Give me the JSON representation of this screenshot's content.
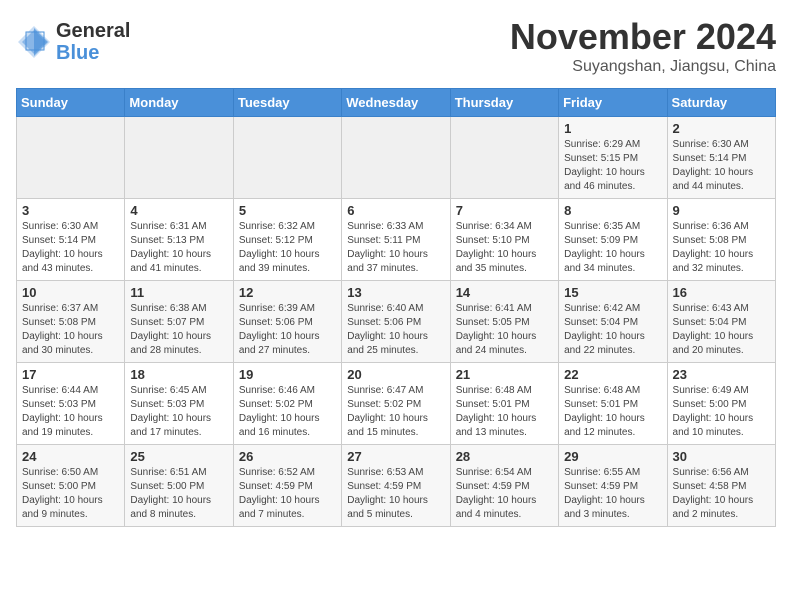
{
  "header": {
    "logo_line1": "General",
    "logo_line2": "Blue",
    "month_title": "November 2024",
    "location": "Suyangshan, Jiangsu, China"
  },
  "days_of_week": [
    "Sunday",
    "Monday",
    "Tuesday",
    "Wednesday",
    "Thursday",
    "Friday",
    "Saturday"
  ],
  "weeks": [
    [
      {
        "day": "",
        "info": ""
      },
      {
        "day": "",
        "info": ""
      },
      {
        "day": "",
        "info": ""
      },
      {
        "day": "",
        "info": ""
      },
      {
        "day": "",
        "info": ""
      },
      {
        "day": "1",
        "info": "Sunrise: 6:29 AM\nSunset: 5:15 PM\nDaylight: 10 hours\nand 46 minutes."
      },
      {
        "day": "2",
        "info": "Sunrise: 6:30 AM\nSunset: 5:14 PM\nDaylight: 10 hours\nand 44 minutes."
      }
    ],
    [
      {
        "day": "3",
        "info": "Sunrise: 6:30 AM\nSunset: 5:14 PM\nDaylight: 10 hours\nand 43 minutes."
      },
      {
        "day": "4",
        "info": "Sunrise: 6:31 AM\nSunset: 5:13 PM\nDaylight: 10 hours\nand 41 minutes."
      },
      {
        "day": "5",
        "info": "Sunrise: 6:32 AM\nSunset: 5:12 PM\nDaylight: 10 hours\nand 39 minutes."
      },
      {
        "day": "6",
        "info": "Sunrise: 6:33 AM\nSunset: 5:11 PM\nDaylight: 10 hours\nand 37 minutes."
      },
      {
        "day": "7",
        "info": "Sunrise: 6:34 AM\nSunset: 5:10 PM\nDaylight: 10 hours\nand 35 minutes."
      },
      {
        "day": "8",
        "info": "Sunrise: 6:35 AM\nSunset: 5:09 PM\nDaylight: 10 hours\nand 34 minutes."
      },
      {
        "day": "9",
        "info": "Sunrise: 6:36 AM\nSunset: 5:08 PM\nDaylight: 10 hours\nand 32 minutes."
      }
    ],
    [
      {
        "day": "10",
        "info": "Sunrise: 6:37 AM\nSunset: 5:08 PM\nDaylight: 10 hours\nand 30 minutes."
      },
      {
        "day": "11",
        "info": "Sunrise: 6:38 AM\nSunset: 5:07 PM\nDaylight: 10 hours\nand 28 minutes."
      },
      {
        "day": "12",
        "info": "Sunrise: 6:39 AM\nSunset: 5:06 PM\nDaylight: 10 hours\nand 27 minutes."
      },
      {
        "day": "13",
        "info": "Sunrise: 6:40 AM\nSunset: 5:06 PM\nDaylight: 10 hours\nand 25 minutes."
      },
      {
        "day": "14",
        "info": "Sunrise: 6:41 AM\nSunset: 5:05 PM\nDaylight: 10 hours\nand 24 minutes."
      },
      {
        "day": "15",
        "info": "Sunrise: 6:42 AM\nSunset: 5:04 PM\nDaylight: 10 hours\nand 22 minutes."
      },
      {
        "day": "16",
        "info": "Sunrise: 6:43 AM\nSunset: 5:04 PM\nDaylight: 10 hours\nand 20 minutes."
      }
    ],
    [
      {
        "day": "17",
        "info": "Sunrise: 6:44 AM\nSunset: 5:03 PM\nDaylight: 10 hours\nand 19 minutes."
      },
      {
        "day": "18",
        "info": "Sunrise: 6:45 AM\nSunset: 5:03 PM\nDaylight: 10 hours\nand 17 minutes."
      },
      {
        "day": "19",
        "info": "Sunrise: 6:46 AM\nSunset: 5:02 PM\nDaylight: 10 hours\nand 16 minutes."
      },
      {
        "day": "20",
        "info": "Sunrise: 6:47 AM\nSunset: 5:02 PM\nDaylight: 10 hours\nand 15 minutes."
      },
      {
        "day": "21",
        "info": "Sunrise: 6:48 AM\nSunset: 5:01 PM\nDaylight: 10 hours\nand 13 minutes."
      },
      {
        "day": "22",
        "info": "Sunrise: 6:48 AM\nSunset: 5:01 PM\nDaylight: 10 hours\nand 12 minutes."
      },
      {
        "day": "23",
        "info": "Sunrise: 6:49 AM\nSunset: 5:00 PM\nDaylight: 10 hours\nand 10 minutes."
      }
    ],
    [
      {
        "day": "24",
        "info": "Sunrise: 6:50 AM\nSunset: 5:00 PM\nDaylight: 10 hours\nand 9 minutes."
      },
      {
        "day": "25",
        "info": "Sunrise: 6:51 AM\nSunset: 5:00 PM\nDaylight: 10 hours\nand 8 minutes."
      },
      {
        "day": "26",
        "info": "Sunrise: 6:52 AM\nSunset: 4:59 PM\nDaylight: 10 hours\nand 7 minutes."
      },
      {
        "day": "27",
        "info": "Sunrise: 6:53 AM\nSunset: 4:59 PM\nDaylight: 10 hours\nand 5 minutes."
      },
      {
        "day": "28",
        "info": "Sunrise: 6:54 AM\nSunset: 4:59 PM\nDaylight: 10 hours\nand 4 minutes."
      },
      {
        "day": "29",
        "info": "Sunrise: 6:55 AM\nSunset: 4:59 PM\nDaylight: 10 hours\nand 3 minutes."
      },
      {
        "day": "30",
        "info": "Sunrise: 6:56 AM\nSunset: 4:58 PM\nDaylight: 10 hours\nand 2 minutes."
      }
    ]
  ]
}
